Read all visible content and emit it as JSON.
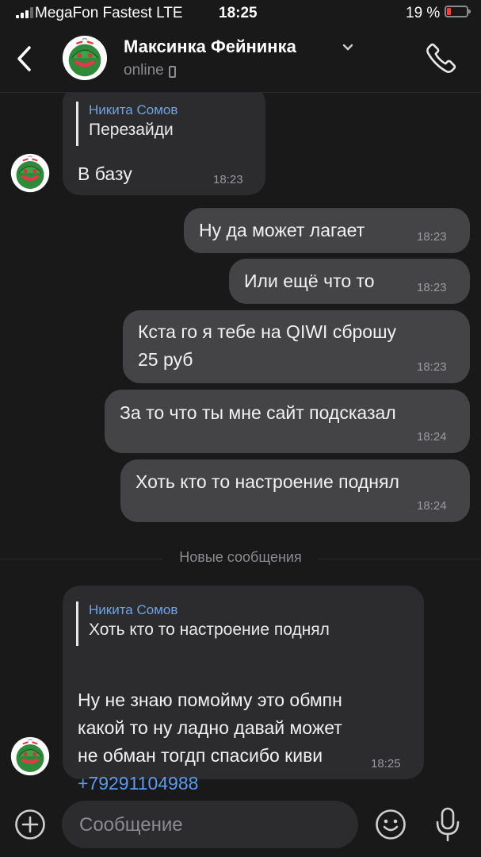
{
  "status_bar": {
    "carrier": "MegaFon Fastest  LTE",
    "time": "18:25",
    "battery": "19 %",
    "battery_level": 0.19
  },
  "header": {
    "contact_name": "Максинка Фейнинка",
    "status": "online"
  },
  "messages": [
    {
      "direction": "in",
      "quote_author": "Никита Сомов",
      "quote_text": "Перезайди",
      "text": "В базу",
      "time": "18:23"
    },
    {
      "direction": "out",
      "text": "Ну да может лагает",
      "time": "18:23"
    },
    {
      "direction": "out",
      "text": "Или ещё что то",
      "time": "18:23"
    },
    {
      "direction": "out",
      "text": "Кста го я тебе на QIWI сброшу\n25 руб",
      "time": "18:23"
    },
    {
      "direction": "out",
      "text": "За то что ты мне сайт подсказал",
      "time": "18:24"
    },
    {
      "direction": "out",
      "text": "Хоть кто то настроение поднял",
      "time": "18:24"
    },
    {
      "direction": "in",
      "quote_author": "Никита Сомов",
      "quote_text": "Хоть кто то настроение поднял",
      "text": "Ну не знаю помойму это обмпн\nкакой то ну ладно давай может\nне обман тогдп спасибо киви",
      "link": "+79291104988",
      "time": "18:25"
    }
  ],
  "divider": "Новые сообщения",
  "composer": {
    "placeholder": "Сообщение"
  },
  "colors": {
    "background": "#19191a",
    "incoming_bubble": "#2c2c2e",
    "outgoing_bubble": "#444446",
    "accent": "#6fa3e6",
    "link": "#5b9bef",
    "battery_low": "#ff3b30"
  },
  "icons": [
    "back-chevron-icon",
    "call-icon",
    "chevron-down-icon",
    "phone-device-icon",
    "plus-icon",
    "emoji-icon",
    "microphone-icon",
    "watermelon-avatar"
  ]
}
